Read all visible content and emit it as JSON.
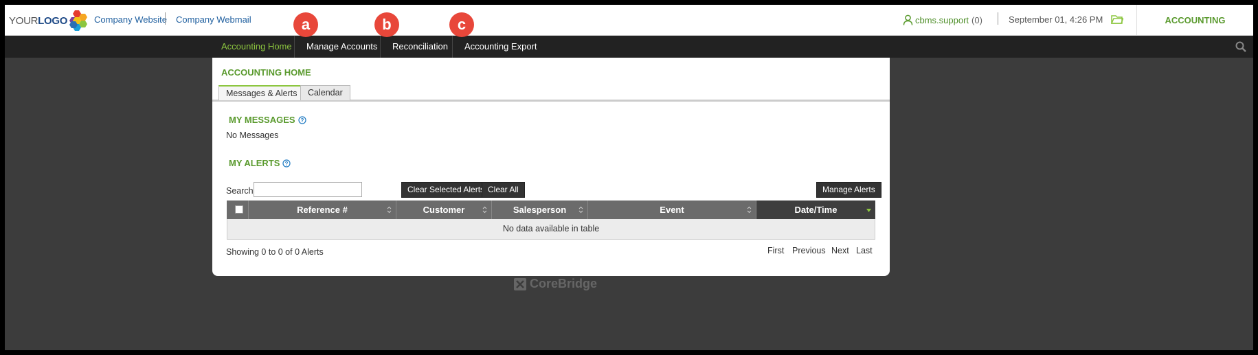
{
  "header": {
    "logo": {
      "part1": "YOUR",
      "part2": "LOGO"
    },
    "links": [
      "Company Website",
      "Company Webmail"
    ],
    "user": {
      "name": "cbms.support",
      "count": "(0)"
    },
    "datetime": "September 01, 4:26 PM",
    "module": "ACCOUNTING"
  },
  "nav": {
    "items": [
      "Accounting Home",
      "Manage Accounts",
      "Reconciliation",
      "Accounting Export"
    ],
    "badges": [
      "a",
      "b",
      "c"
    ]
  },
  "main": {
    "title": "ACCOUNTING HOME",
    "tabs": [
      "Messages & Alerts",
      "Calendar"
    ],
    "messages": {
      "heading": "MY MESSAGES",
      "empty": "No Messages"
    },
    "alerts": {
      "heading": "MY ALERTS",
      "search_label": "Search:",
      "search_value": "",
      "buttons": {
        "clear_selected": "Clear Selected Alerts",
        "clear_all": "Clear All",
        "manage": "Manage Alerts"
      },
      "columns": [
        "Reference #",
        "Customer",
        "Salesperson",
        "Event",
        "Date/Time"
      ],
      "empty": "No data available in table",
      "showing": "Showing 0 to 0 of 0 Alerts",
      "pager": [
        "First",
        "Previous",
        "Next",
        "Last"
      ]
    }
  },
  "footer": {
    "brand": "CoreBridge"
  },
  "colors": {
    "accent_green": "#5a9a2e",
    "nav_bg": "#222222",
    "badge_red": "#e8473a",
    "link_blue": "#1f5f9f"
  }
}
